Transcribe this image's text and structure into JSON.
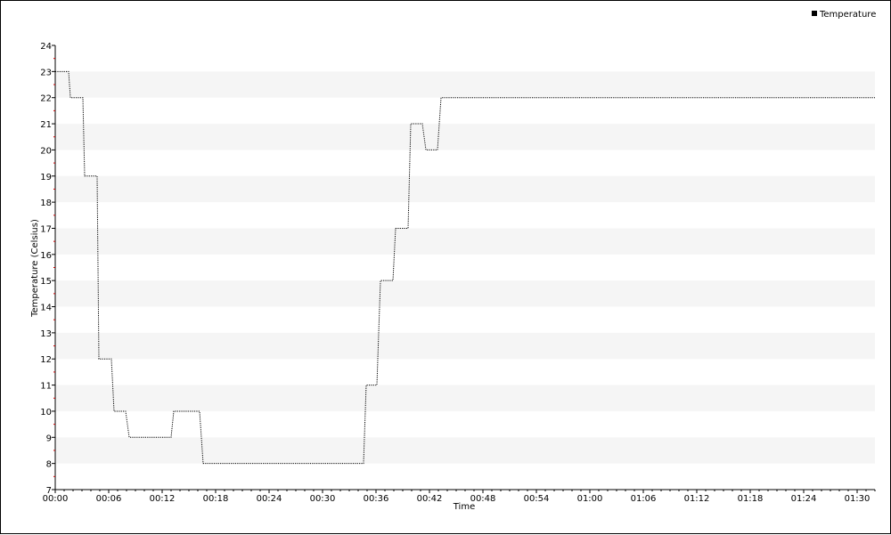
{
  "chart_data": {
    "type": "line",
    "title": "",
    "xlabel": "Time",
    "ylabel": "Temperature (Celsius)",
    "xlim": [
      0,
      92
    ],
    "ylim": [
      7,
      24
    ],
    "x_unit": "minutes",
    "x_tick_labels": [
      "00:00",
      "00:06",
      "00:12",
      "00:18",
      "00:24",
      "00:30",
      "00:36",
      "00:42",
      "00:48",
      "00:54",
      "01:00",
      "01:06",
      "01:12",
      "01:18",
      "01:24",
      "01:30"
    ],
    "y_tick_labels": [
      "7",
      "8",
      "9",
      "10",
      "11",
      "12",
      "13",
      "14",
      "15",
      "16",
      "17",
      "18",
      "19",
      "20",
      "21",
      "22",
      "23",
      "24"
    ],
    "grid": "alternating horizontal bands",
    "legend_position": "top-right",
    "line_style": "dotted",
    "colors": {
      "series": "#000000",
      "band": "#f5f5f5",
      "minor_tick": "#cc0000"
    },
    "series": [
      {
        "name": "Temperature",
        "points": [
          [
            "00:00",
            23
          ],
          [
            "00:01.5",
            23
          ],
          [
            "00:01.7",
            22
          ],
          [
            "00:03.1",
            22
          ],
          [
            "00:03.3",
            19
          ],
          [
            "00:04.7",
            19
          ],
          [
            "00:04.9",
            12
          ],
          [
            "00:06.3",
            12
          ],
          [
            "00:06.6",
            10
          ],
          [
            "00:07.9",
            10
          ],
          [
            "00:08.3",
            9
          ],
          [
            "00:13.0",
            9
          ],
          [
            "00:13.3",
            10
          ],
          [
            "00:16.2",
            10
          ],
          [
            "00:16.6",
            8
          ],
          [
            "00:34.6",
            8
          ],
          [
            "00:34.9",
            11
          ],
          [
            "00:36.1",
            11
          ],
          [
            "00:36.5",
            15
          ],
          [
            "00:37.9",
            15
          ],
          [
            "00:38.2",
            17
          ],
          [
            "00:39.6",
            17
          ],
          [
            "00:39.9",
            21
          ],
          [
            "00:41.2",
            21
          ],
          [
            "00:41.6",
            20
          ],
          [
            "00:42.9",
            20
          ],
          [
            "00:43.3",
            22
          ],
          [
            "01:32.0",
            22
          ]
        ]
      }
    ]
  }
}
